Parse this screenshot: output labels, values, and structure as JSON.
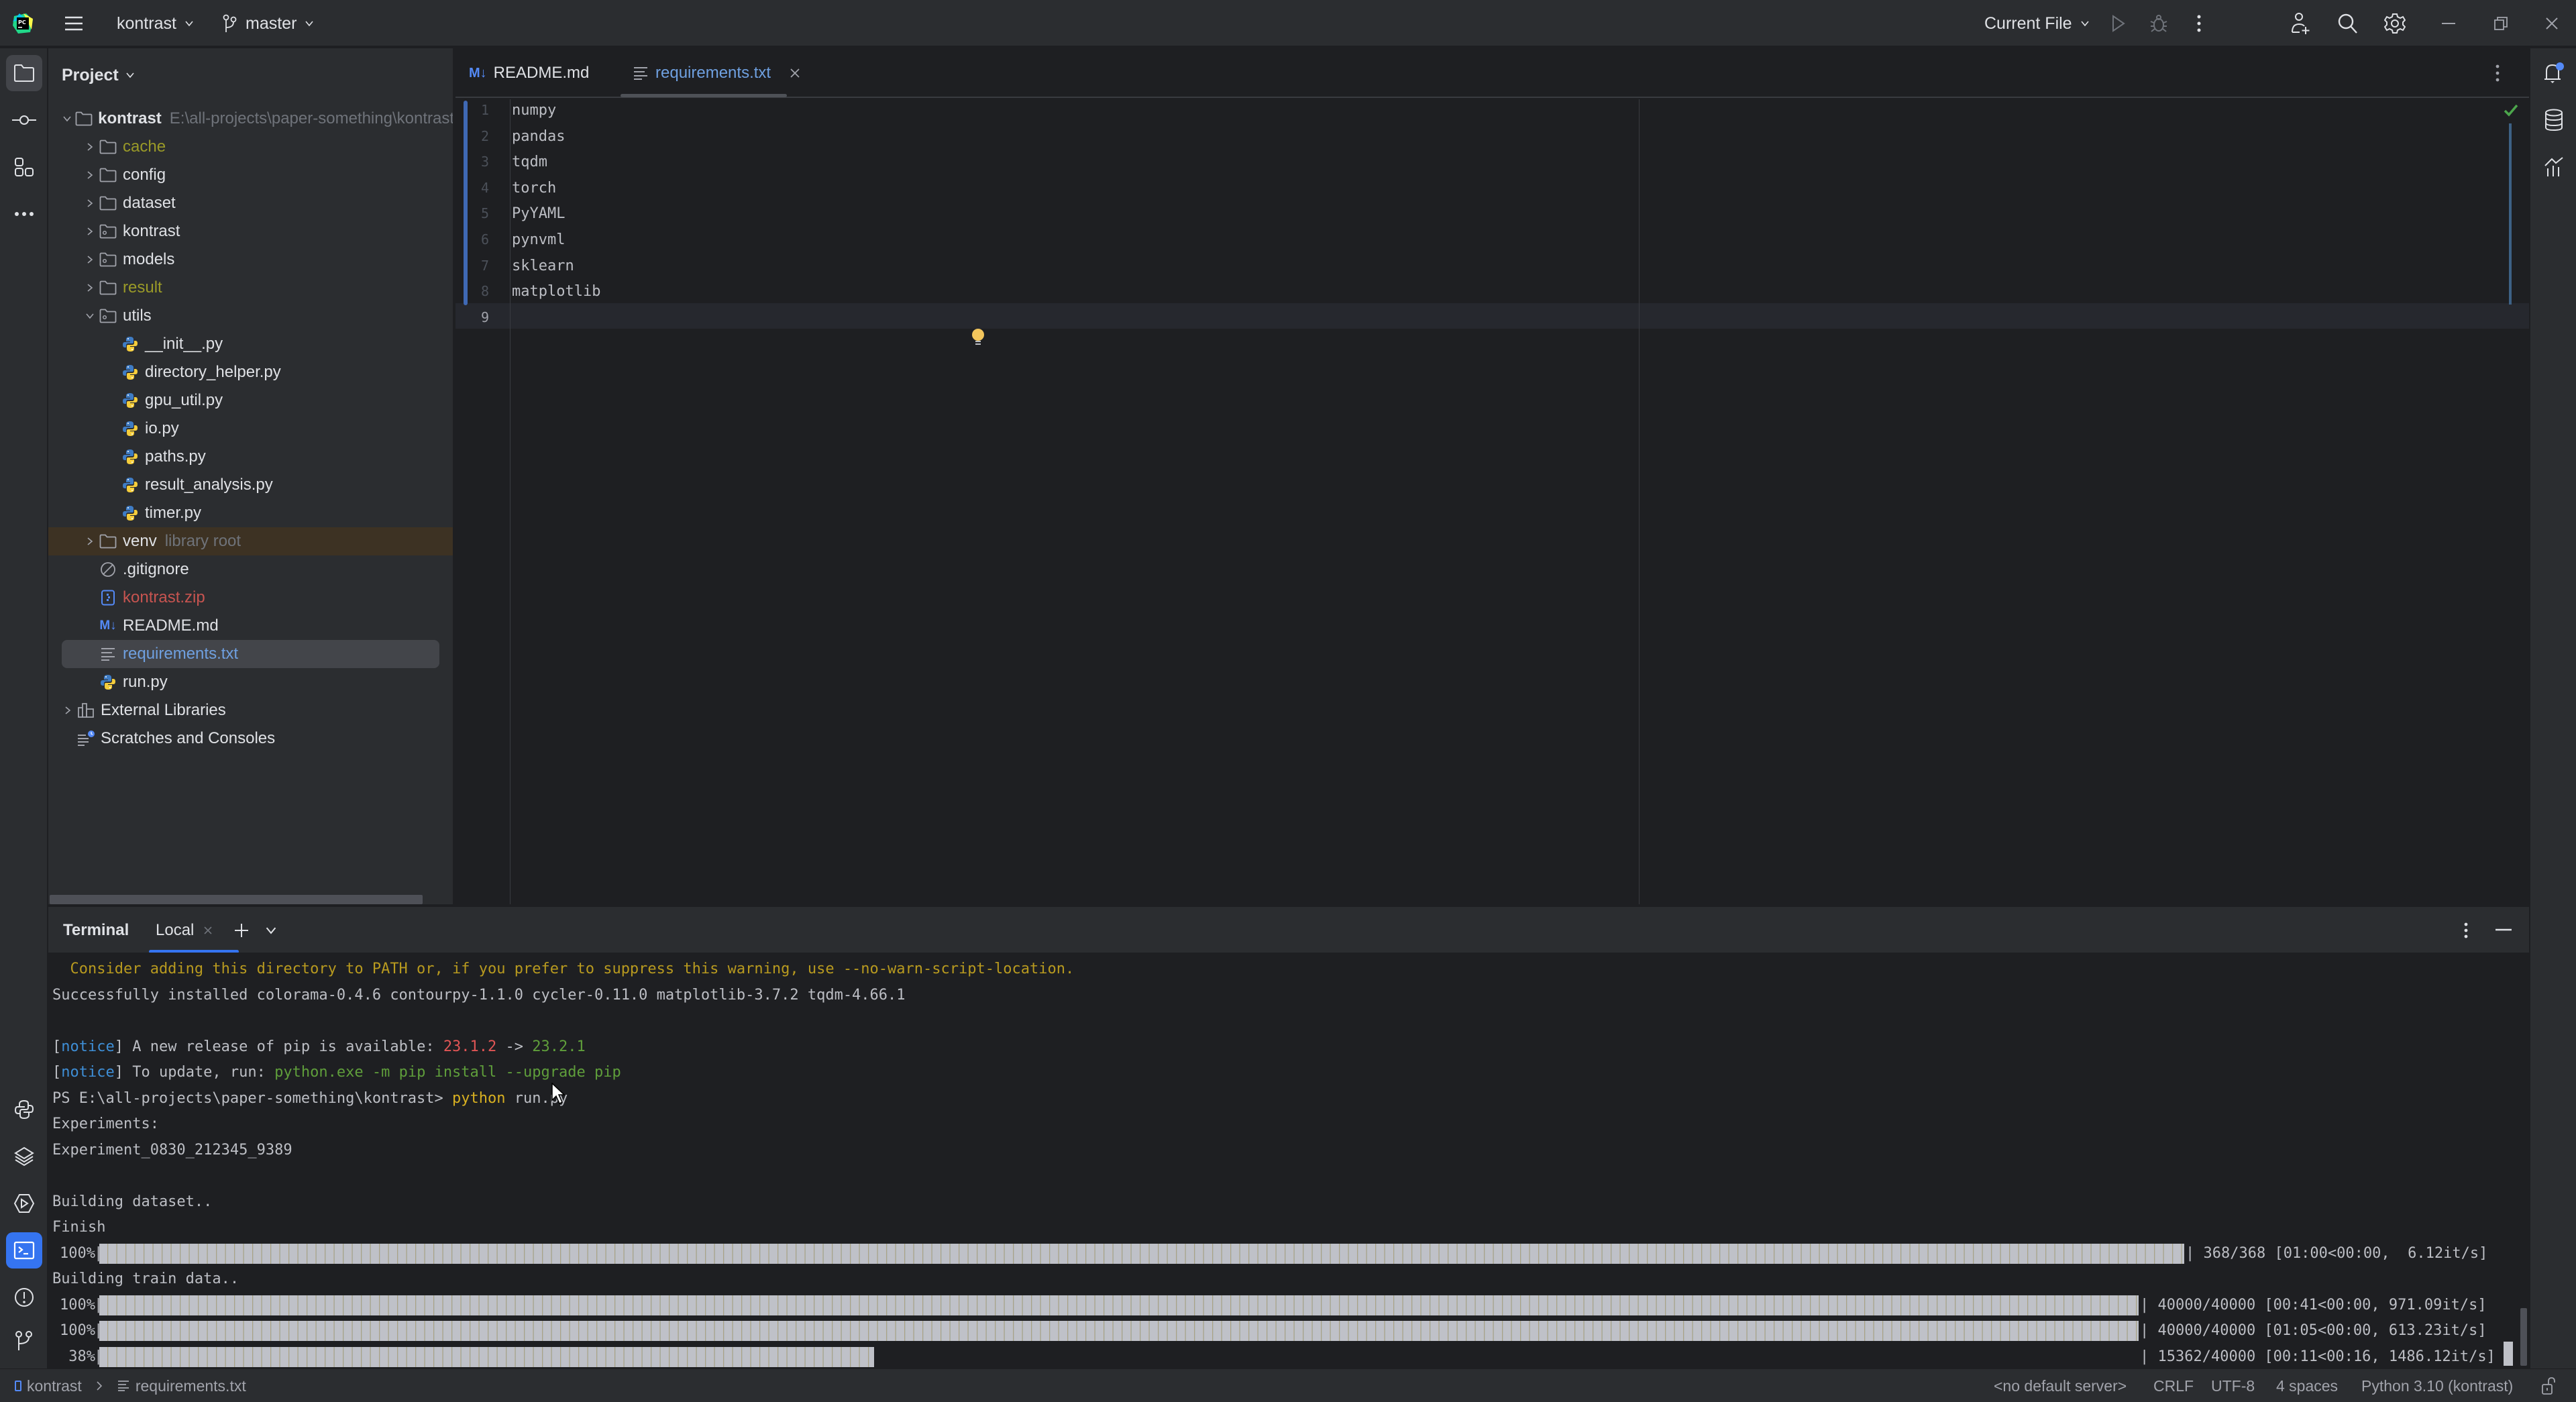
{
  "titlebar": {
    "app_icon": "pycharm-logo",
    "project_name": "kontrast",
    "branch": "master",
    "run_config": "Current File",
    "window_controls": [
      "minimize",
      "restore",
      "close"
    ]
  },
  "left_strip": {
    "top_tools": [
      "Project",
      "Commit",
      "Structure",
      "More"
    ],
    "bottom_tools": [
      "Python Console",
      "Services",
      "Run",
      "Terminal",
      "Problems",
      "Version Control"
    ],
    "active": "Terminal"
  },
  "right_strip": {
    "tools": [
      "Notifications",
      "Database",
      "SciView"
    ],
    "notification_badge": true
  },
  "project_panel": {
    "title": "Project",
    "root": {
      "name": "kontrast",
      "path": "E:\\all-projects\\paper-something\\kontrast"
    },
    "items": [
      {
        "name": "cache",
        "type": "folder",
        "level": 1,
        "expanded": false,
        "style": "ignored"
      },
      {
        "name": "config",
        "type": "folder",
        "level": 1,
        "expanded": false,
        "style": "normal"
      },
      {
        "name": "dataset",
        "type": "folder",
        "level": 1,
        "expanded": false,
        "style": "normal"
      },
      {
        "name": "kontrast",
        "type": "package",
        "level": 1,
        "expanded": false,
        "style": "normal"
      },
      {
        "name": "models",
        "type": "package",
        "level": 1,
        "expanded": false,
        "style": "normal"
      },
      {
        "name": "result",
        "type": "folder",
        "level": 1,
        "expanded": false,
        "style": "ignored"
      },
      {
        "name": "utils",
        "type": "package",
        "level": 1,
        "expanded": true,
        "style": "normal"
      },
      {
        "name": "__init__.py",
        "type": "python",
        "level": 2
      },
      {
        "name": "directory_helper.py",
        "type": "python",
        "level": 2
      },
      {
        "name": "gpu_util.py",
        "type": "python",
        "level": 2
      },
      {
        "name": "io.py",
        "type": "python",
        "level": 2
      },
      {
        "name": "paths.py",
        "type": "python",
        "level": 2
      },
      {
        "name": "result_analysis.py",
        "type": "python",
        "level": 2
      },
      {
        "name": "timer.py",
        "type": "python",
        "level": 2
      },
      {
        "name": "venv",
        "type": "folder",
        "level": 1,
        "expanded": false,
        "hint": "library root"
      },
      {
        "name": ".gitignore",
        "type": "ignore-file",
        "level": 1
      },
      {
        "name": "kontrast.zip",
        "type": "archive",
        "level": 1,
        "style": "unversioned"
      },
      {
        "name": "README.md",
        "type": "markdown",
        "level": 1
      },
      {
        "name": "requirements.txt",
        "type": "text",
        "level": 1,
        "selected": true
      },
      {
        "name": "run.py",
        "type": "python",
        "level": 1
      },
      {
        "name": "External Libraries",
        "type": "libraries",
        "level": 0,
        "expanded": false
      },
      {
        "name": "Scratches and Consoles",
        "type": "scratches",
        "level": 0
      }
    ]
  },
  "editor": {
    "tabs": [
      {
        "label": "README.md",
        "icon": "M↓",
        "active": false
      },
      {
        "label": "requirements.txt",
        "icon": "text-file",
        "active": true,
        "closable": true
      }
    ],
    "lines": [
      "numpy",
      "pandas",
      "tqdm",
      "torch",
      "PyYAML",
      "pynvml",
      "sklearn",
      "matplotlib",
      ""
    ],
    "current_line": 9,
    "inspection_status": "ok"
  },
  "terminal": {
    "title": "Terminal",
    "tab_label": "Local",
    "lines": [
      {
        "segments": [
          {
            "text": "  Consider adding this directory to PATH or, if you prefer to suppress this warning, use --no-warn-script-location.",
            "color": "warn"
          }
        ]
      },
      {
        "segments": [
          {
            "text": "Successfully installed colorama-0.4.6 contourpy-1.1.0 cycler-0.11.0 matplotlib-3.7.2 tqdm-4.66.1",
            "color": "default"
          }
        ]
      },
      {
        "segments": [
          {
            "text": "",
            "color": "default"
          }
        ]
      },
      {
        "segments": [
          {
            "text": "[",
            "color": "default"
          },
          {
            "text": "notice",
            "color": "notice"
          },
          {
            "text": "] A new release of pip is available: ",
            "color": "default"
          },
          {
            "text": "23.1.2",
            "color": "red"
          },
          {
            "text": " -> ",
            "color": "default"
          },
          {
            "text": "23.2.1",
            "color": "green"
          }
        ]
      },
      {
        "segments": [
          {
            "text": "[",
            "color": "default"
          },
          {
            "text": "notice",
            "color": "notice"
          },
          {
            "text": "] To update, run: ",
            "color": "default"
          },
          {
            "text": "python.exe -m pip install --upgrade pip",
            "color": "green"
          }
        ]
      },
      {
        "segments": [
          {
            "text": "PS E:\\all-projects\\paper-something\\kontrast> ",
            "color": "default"
          },
          {
            "text": "python",
            "color": "yellow"
          },
          {
            "text": " run.py",
            "color": "default"
          }
        ]
      },
      {
        "segments": [
          {
            "text": "Experiments:",
            "color": "default"
          }
        ]
      },
      {
        "segments": [
          {
            "text": "Experiment_0830_212345_9389",
            "color": "default"
          }
        ]
      },
      {
        "segments": [
          {
            "text": "",
            "color": "default"
          }
        ]
      },
      {
        "segments": [
          {
            "text": "Building dataset..",
            "color": "default"
          }
        ]
      },
      {
        "segments": [
          {
            "text": "Finish",
            "color": "default"
          }
        ]
      }
    ],
    "progress_bars": [
      {
        "label": "100%",
        "fraction": 1.0,
        "stats": "| 368/368 [01:00<00:00,  6.12it/s]",
        "after_line": "Finish"
      },
      {
        "label": "100%",
        "fraction": 1.0,
        "stats": "| 40000/40000 [00:41<00:00, 971.09it/s]",
        "after_line": "Building train data.."
      },
      {
        "label": "100%",
        "fraction": 1.0,
        "stats": "| 40000/40000 [01:05<00:00, 613.23it/s]"
      },
      {
        "label": " 38%",
        "fraction": 0.38,
        "stats": "| 15362/40000 [00:11<00:16, 1486.12it/s]"
      }
    ],
    "line_between": "Building train data.."
  },
  "statusbar": {
    "breadcrumb": [
      "kontrast",
      "requirements.txt"
    ],
    "server": "<no default server>",
    "line_separator": "CRLF",
    "encoding": "UTF-8",
    "indent": "4 spaces",
    "interpreter": "Python 3.10 (kontrast)",
    "lock_icon": "unlocked"
  }
}
